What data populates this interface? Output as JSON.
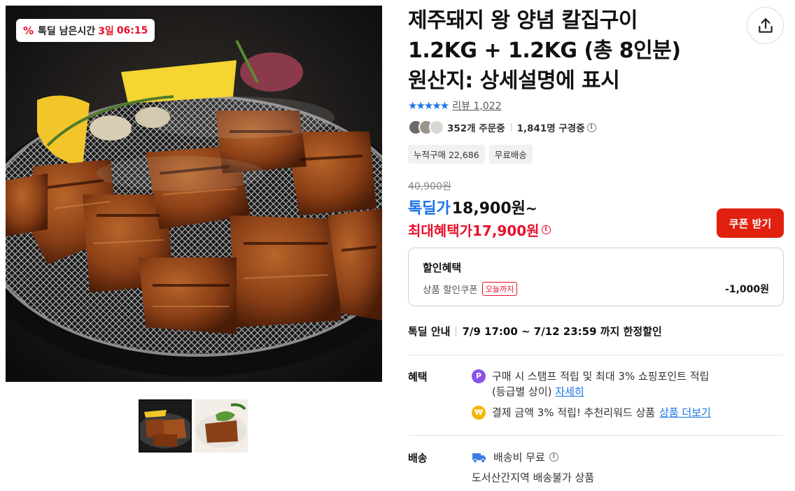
{
  "deal_timer": {
    "icon": "percent-icon",
    "label": "톡딜 남은시간",
    "days": "3일",
    "time": "06:15"
  },
  "product": {
    "title_line1": "제주돼지 왕 양념 칼집구이",
    "title_line2": "1.2KG + 1.2KG (총 8인분)",
    "title_line3": "원산지: 상세설명에 표시"
  },
  "rating": {
    "stars": "★★★★★",
    "reviews": "리뷰 1,022"
  },
  "social": {
    "orders": "352개 주문중",
    "viewers": "1,841명 구경중"
  },
  "chips": [
    "누적구매 22,686",
    "무료배송"
  ],
  "price": {
    "original": "40,900원",
    "deal_label": "톡딜가",
    "deal_price": "18,900원",
    "deal_suffix": "~",
    "max_label": "최대혜택가",
    "max_price": "17,900원",
    "coupon_button": "쿠폰 받기"
  },
  "discount": {
    "heading": "할인혜택",
    "item_label": "상품 할인쿠폰",
    "item_badge": "오늘까지",
    "item_amount": "-1,000원"
  },
  "deal_info": {
    "label": "톡딜 안내",
    "text": "7/9 17:00 ~ 7/12 23:59 까지 한정할인"
  },
  "benefits": {
    "label": "혜택",
    "line1_text": "구매 시 스탬프 적립 및 최대 3% 쇼핑포인트 적립",
    "line1_text2": "(등급별 상이)",
    "line1_link": "자세히",
    "line1_coin": "P",
    "line2_text": "결제 금액 3% 적립! 추천리워드 상품",
    "line2_link": "상품 더보기",
    "line2_coin": "₩"
  },
  "shipping": {
    "label": "배송",
    "fee": "배송비 무료",
    "note": "도서산간지역 배송불가 상품"
  },
  "colors": {
    "accent_blue": "#1a73e8",
    "accent_red": "#e8102b",
    "coupon_red": "#e0210f"
  }
}
